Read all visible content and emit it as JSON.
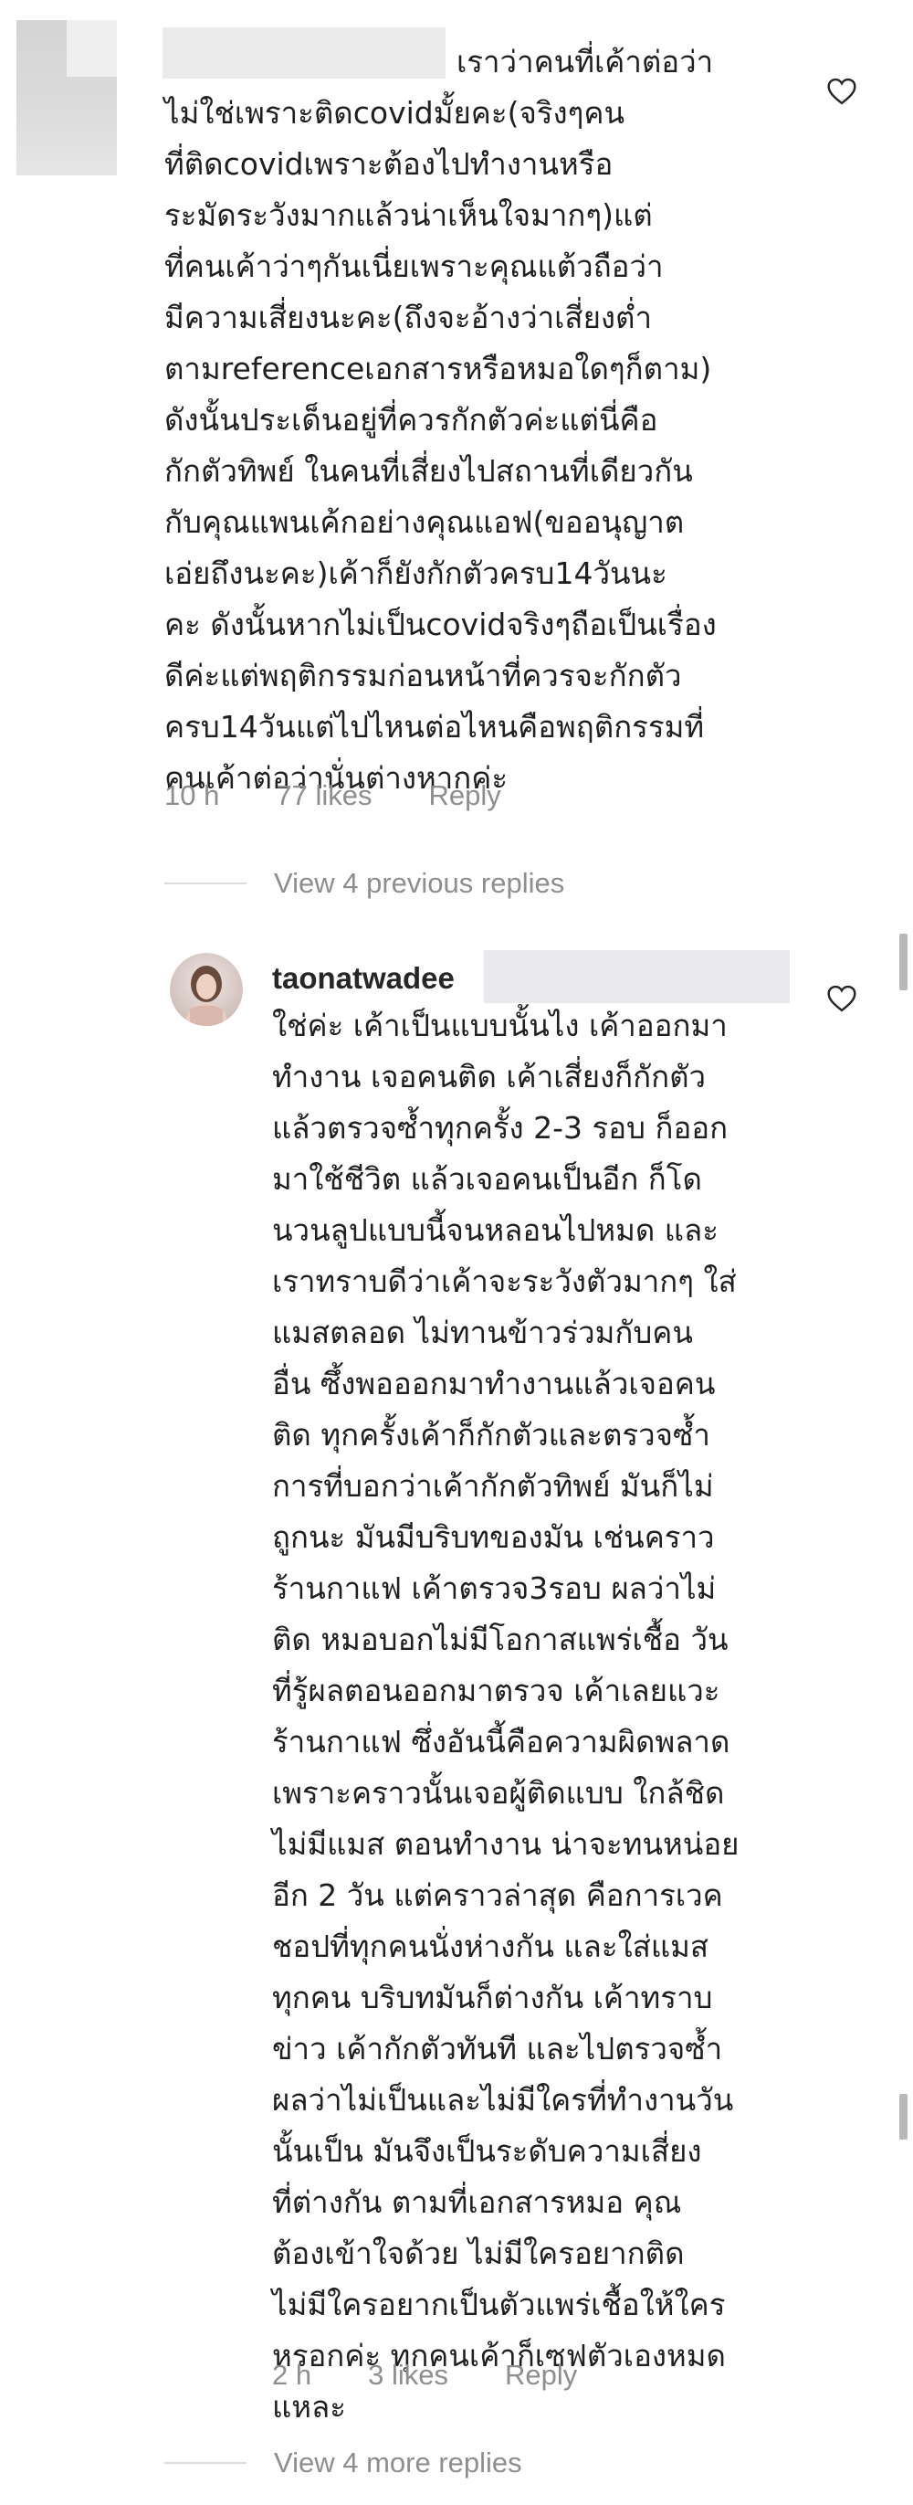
{
  "comment1": {
    "lines": [
      "เราว่าคนที่เค้าต่อว่า",
      "ไม่ใช่เพราะติดcovidมั้ยคะ(จริงๆคน",
      "ที่ติดcovidเพราะต้องไปทำงานหรือ",
      "ระมัดระวังมากแล้วน่าเห็นใจมากๆ)แต่",
      "ที่คนเค้าว่าๆกันเนี่ยเพราะคุณแต้วถือว่า",
      "มีความเสี่ยงนะคะ(ถึงจะอ้างว่าเสี่ยงต่ำ",
      "ตามreferenceเอกสารหรือหมอใดๆก็ตาม)",
      "ดังนั้นประเด็นอยู่ที่ควรกักตัวค่ะแต่นี่คือ",
      "กักตัวทิพย์ ในคนที่เสี่ยงไปสถานที่เดียวกัน",
      "กับคุณแพนเค้กอย่างคุณแอฟ(ขออนุญาต",
      "เอ่ยถึงนะคะ)เค้าก็ยังกักตัวครบ14วันนะ",
      "คะ ดังนั้นหากไม่เป็นcovidจริงๆถือเป็นเรื่อง",
      "ดีค่ะแต่พฤติกรรมก่อนหน้าที่ควรจะกักตัว",
      "ครบ14วันแต่ไปไหนต่อไหนคือพฤติกรรมที่",
      "คนเค้าต่อว่านั่นต่างหากค่ะ"
    ],
    "time": "10 h",
    "likes": "77 likes",
    "reply": "Reply"
  },
  "view_previous": "View 4 previous replies",
  "comment2": {
    "username": "taonatwadee",
    "lines": [
      "ใช่ค่ะ เค้าเป็นแบบนั้นไง เค้าออกมา",
      "ทำงาน เจอคนติด เค้าเสี่ยงก็กักตัว",
      "แล้วตรวจซ้ำทุกครั้ง 2-3 รอบ ก็ออก",
      "มาใช้ชีวิต แล้วเจอคนเป็นอีก ก็โด",
      "นวนลูปแบบนี้จนหลอนไปหมด และ",
      "เราทราบดีว่าเค้าจะระวังตัวมากๆ ใส่",
      "แมสตลอด ไม่ทานข้าวร่วมกับคน",
      "อื่น  ซึ้งพอออกมาทำงานแล้วเจอคน",
      "ติด ทุกครั้งเค้าก็กักตัวและตรวจซ้ำ",
      "การที่บอกว่าเค้ากักตัวทิพย์ มันก็ไม่",
      "ถูกนะ มันมีบริบทของมัน เช่นคราว",
      "ร้านกาแฟ เค้าตรวจ3รอบ ผลว่าไม่",
      "ติด  หมอบอกไม่มีโอกาสแพร่เชื้อ วัน",
      "ที่รู้ผลตอนออกมาตรวจ เค้าเลยแวะ",
      "ร้านกาแฟ ซึ่งอันนี้คือความผิดพลาด",
      "เพราะคราวนั้นเจอผู้ติดแบบ ใกล้ชิด",
      "ไม่มีแมส ตอนทำงาน น่าจะทนหน่อย",
      "อีก 2 วัน แต่คราวล่าสุด คือการเวค",
      "ชอปที่ทุกคนนั่งห่างกัน และใส่แมส",
      "ทุกคน บริบทมันก็ต่างกัน เค้าทราบ",
      "ข่าว เค้ากักตัวทันที และไปตรวจซ้ำ",
      "ผลว่าไม่เป็นและไม่มีใครที่ทำงานวัน",
      "นั้นเป็น มันจึงเป็นระดับความเสี่ยง",
      "ที่ต่างกัน ตามที่เอกสารหมอ  คุณ",
      "ต้องเข้าใจด้วย ไม่มีใครอยากติด",
      "ไม่มีใครอยากเป็นตัวแพร่เชื้อให้ใคร",
      "หรอกค่ะ ทุกคนเค้าก็เซฟตัวเองหมด",
      "แหละ"
    ],
    "time": "2 h",
    "likes": "3 likes",
    "reply": "Reply"
  },
  "view_more": "View 4 more replies",
  "icons": {
    "like": "heart-outline-icon",
    "avatar": "profile-photo"
  },
  "colors": {
    "text": "#262626",
    "meta": "#8e8e8e",
    "rule": "#dbdbdb"
  }
}
